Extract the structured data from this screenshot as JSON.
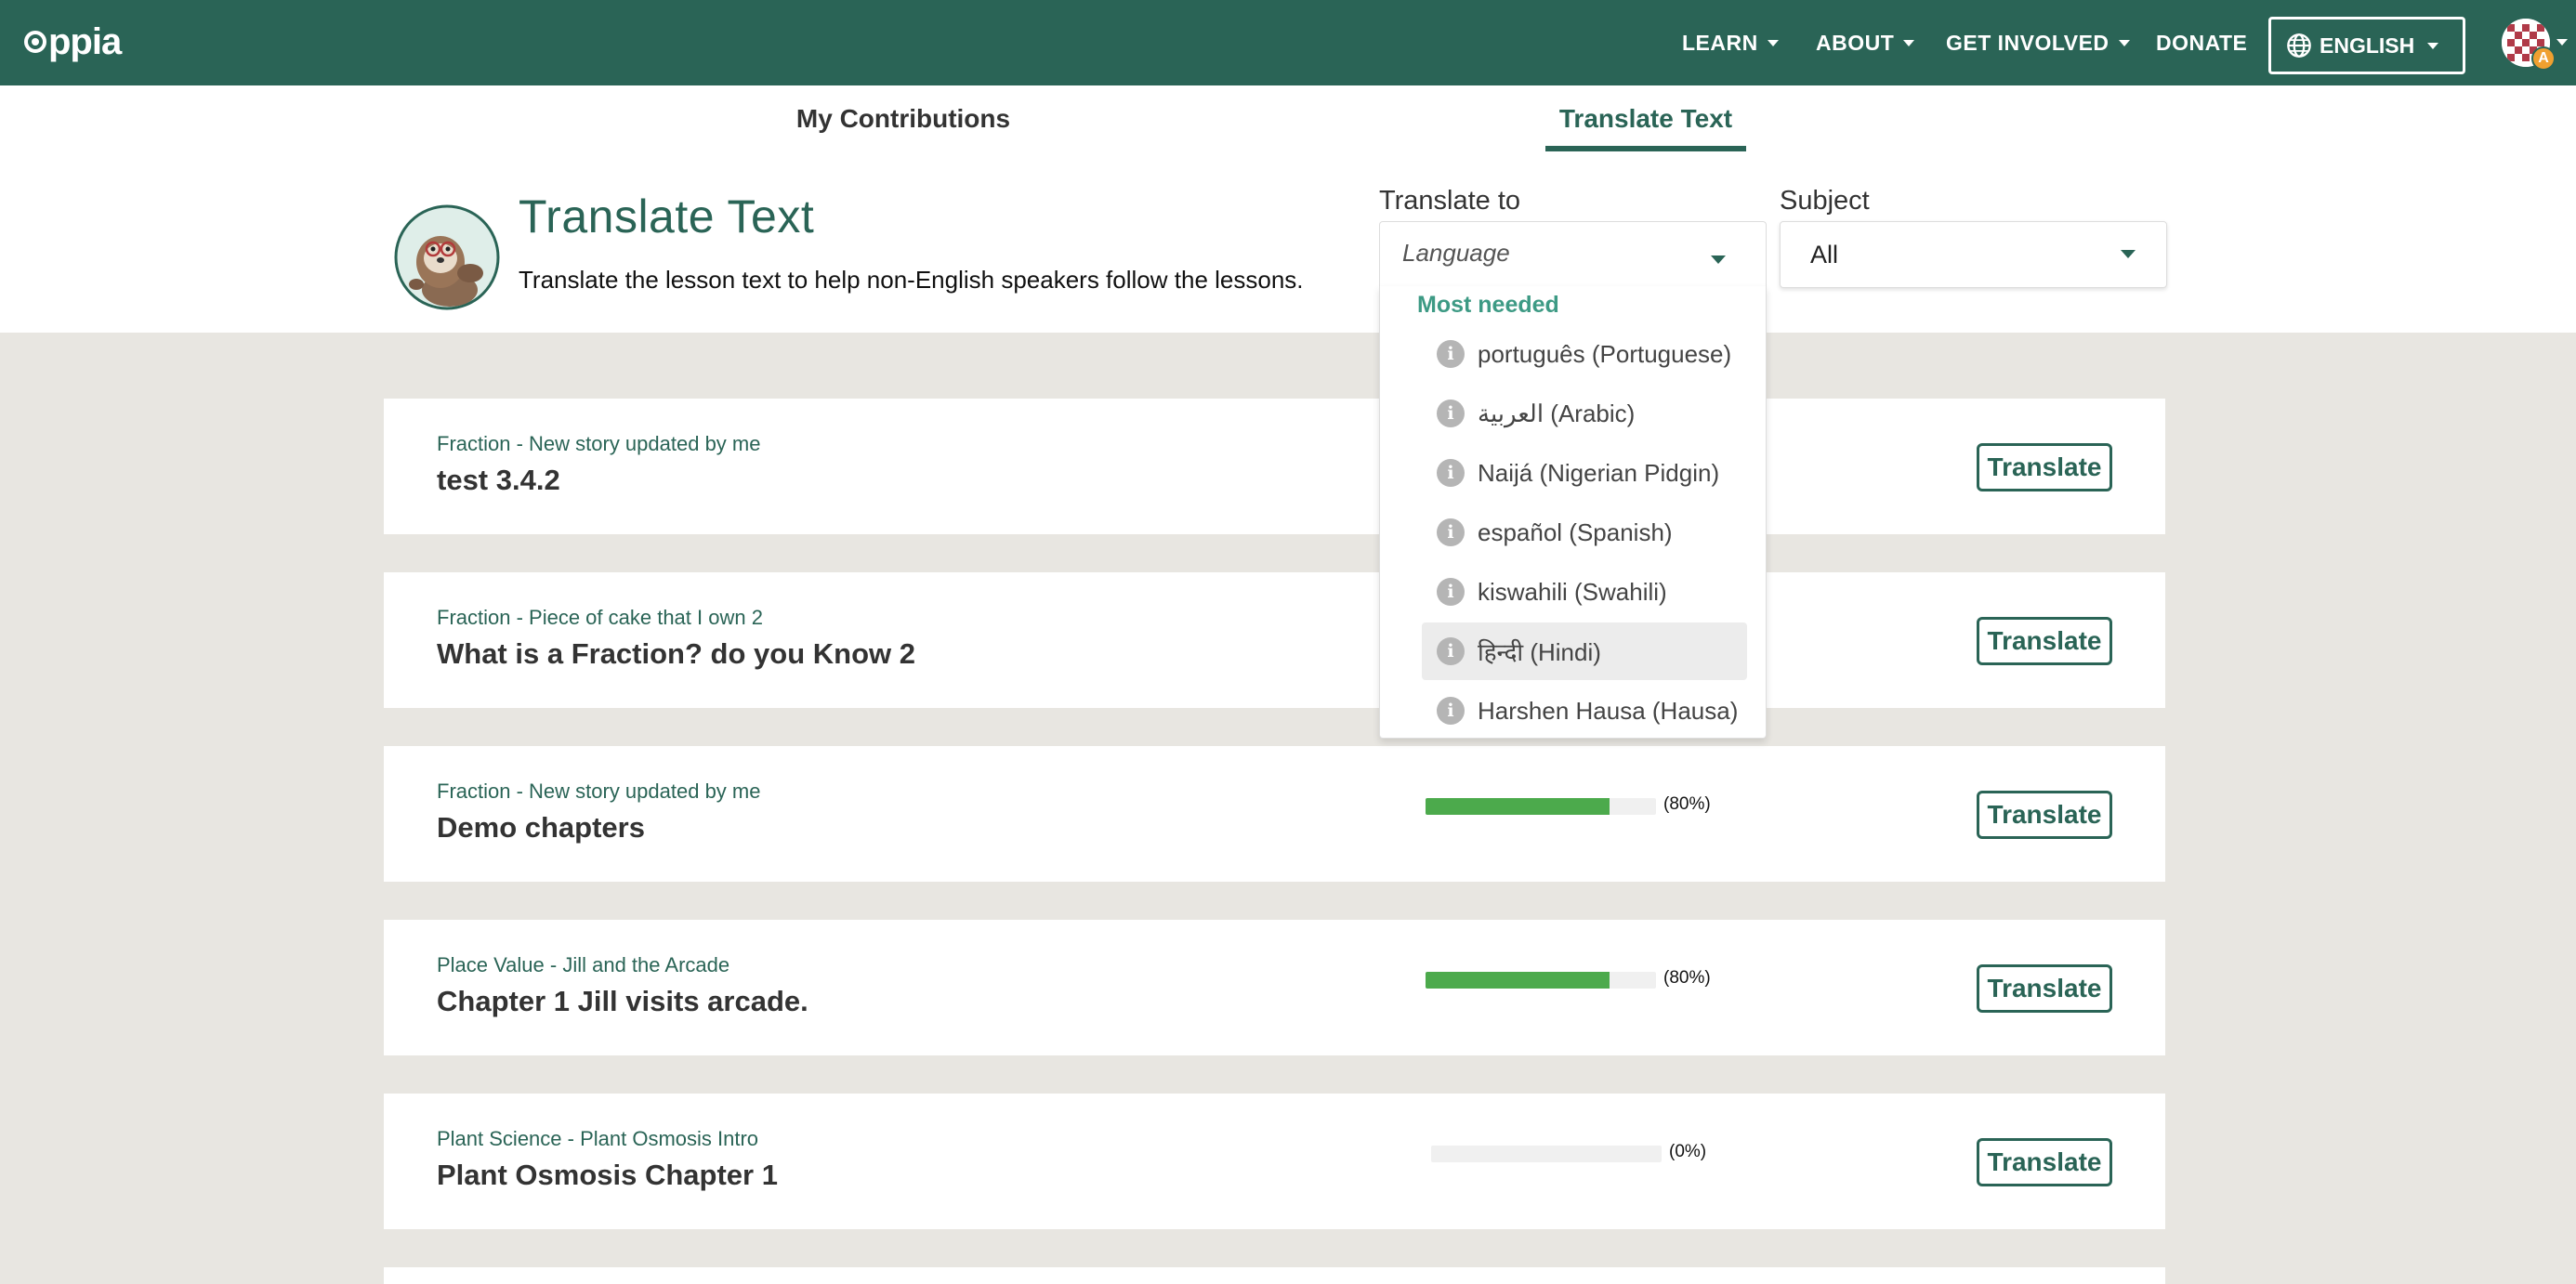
{
  "navbar": {
    "logo_text": "ppia",
    "items": [
      {
        "label": "LEARN"
      },
      {
        "label": "ABOUT"
      },
      {
        "label": "GET INVOLVED"
      },
      {
        "label": "DONATE"
      }
    ],
    "language_button": "ENGLISH",
    "avatar_badge": "A"
  },
  "tabs": [
    {
      "label": "My Contributions",
      "active": false
    },
    {
      "label": "Translate Text",
      "active": true
    }
  ],
  "header": {
    "title": "Translate Text",
    "subtitle": "Translate the lesson text to help non-English speakers follow the lessons."
  },
  "filters": {
    "translate_to": {
      "label": "Translate to",
      "placeholder": "Language"
    },
    "subject": {
      "label": "Subject",
      "value": "All"
    }
  },
  "language_dropdown": {
    "group_label": "Most needed",
    "options": [
      {
        "label": "português (Portuguese)"
      },
      {
        "label": "العربية (Arabic)"
      },
      {
        "label": "Naijá (Nigerian Pidgin)"
      },
      {
        "label": "español (Spanish)"
      },
      {
        "label": "kiswahili (Swahili)"
      },
      {
        "label": "हिन्दी (Hindi)",
        "highlighted": true
      },
      {
        "label": "Harshen Hausa (Hausa)"
      }
    ]
  },
  "opportunities": [
    {
      "topic": "Fraction - New story updated by me",
      "chapter": "test 3.4.2",
      "button": "Translate"
    },
    {
      "topic": "Fraction - Piece of cake that I own 2",
      "chapter": "What is a Fraction? do you Know 2",
      "button": "Translate"
    },
    {
      "topic": "Fraction - New story updated by me",
      "chapter": "Demo chapters",
      "progress": 0.8,
      "progress_label": "(80%)",
      "button": "Translate"
    },
    {
      "topic": "Place Value - Jill and the Arcade",
      "chapter": "Chapter 1 Jill visits arcade.",
      "progress": 0.8,
      "progress_label": "(80%)",
      "button": "Translate"
    },
    {
      "topic": "Plant Science - Plant Osmosis Intro",
      "chapter": "Plant Osmosis Chapter 1",
      "progress": 0,
      "progress_label": "(0%)",
      "button": "Translate"
    }
  ],
  "colors": {
    "brand": "#2a6456",
    "accent": "#3d9a84",
    "progress": "#4caa4c",
    "page_bg": "#e8e6e1"
  }
}
